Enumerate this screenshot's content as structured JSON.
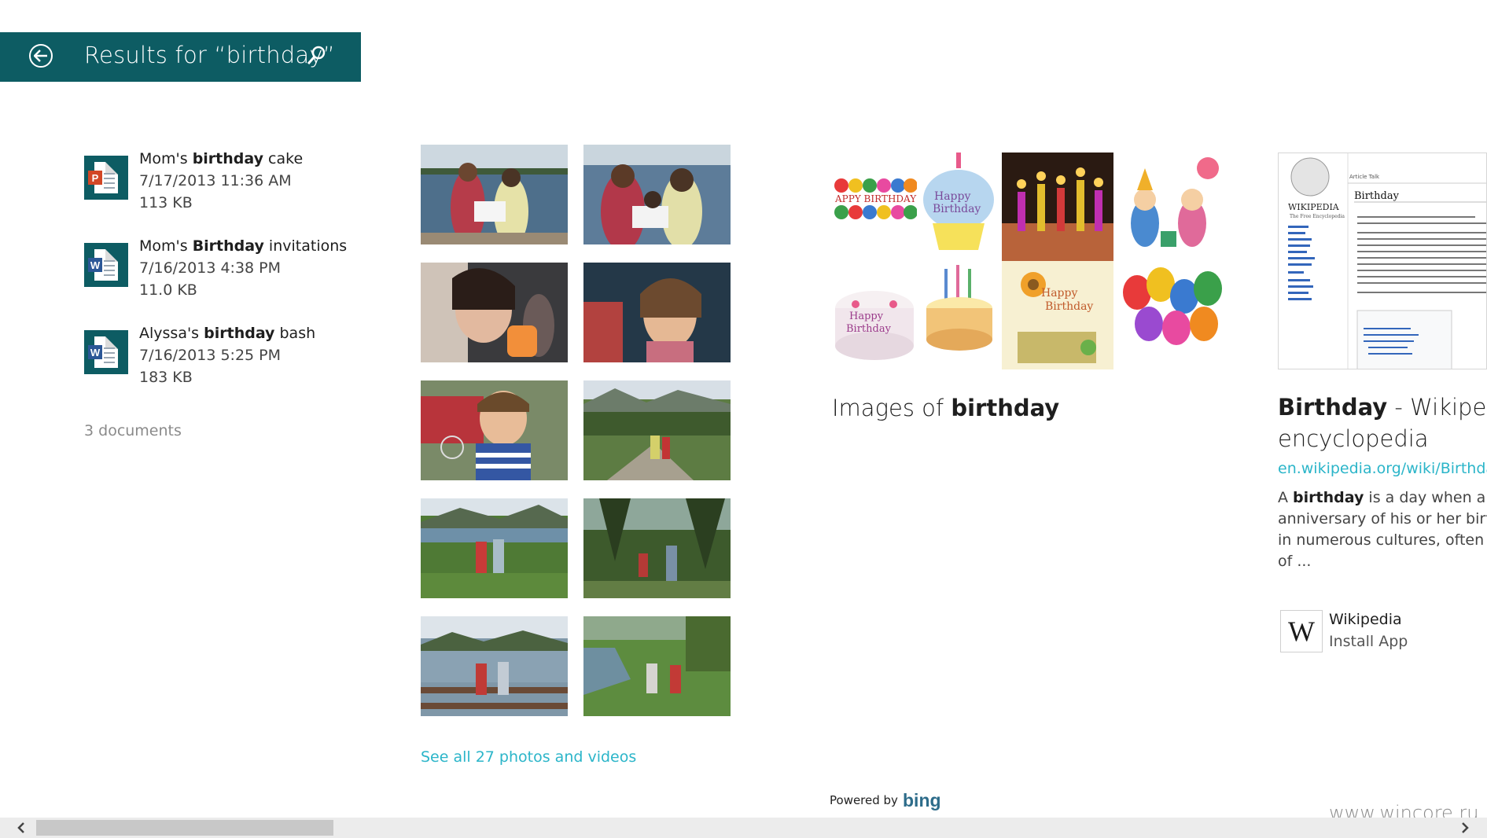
{
  "header": {
    "back_icon": "back-arrow-icon",
    "title": "Results for “birthday”",
    "search_icon": "search-icon",
    "color": "#0d5c63"
  },
  "documents": {
    "items": [
      {
        "pre": "Mom's ",
        "bold": "birthday",
        "post": " cake",
        "date": "7/17/2013 11:36 AM",
        "size": "113 KB",
        "type": "ppt",
        "badge": "P"
      },
      {
        "pre": "Mom's ",
        "bold": "Birthday",
        "post": " invitations",
        "date": "7/16/2013 4:38 PM",
        "size": "11.0 KB",
        "type": "word",
        "badge": "W"
      },
      {
        "pre": "Alyssa's ",
        "bold": "birthday",
        "post": " bash",
        "date": "7/16/2013 5:25 PM",
        "size": "183 KB",
        "type": "word",
        "badge": "W"
      }
    ],
    "count_label": "3 documents"
  },
  "photos": {
    "see_all": "See all 27 photos and videos"
  },
  "bing_images": {
    "caption_pre": "Images of ",
    "caption_bold": "birthday"
  },
  "wikipedia": {
    "thumb_logo_text": "WIKIPEDIA",
    "thumb_tagline": "The Free Encyclopedia",
    "thumb_heading": "Birthday",
    "thumb_tabs": "Article  Talk",
    "title_bold": "Birthday",
    "title_rest": " - Wikipedia,",
    "title_line2": "encyclopedia",
    "url": "en.wikipedia.org/wiki/Birthday",
    "snippet_line1_pre": "A ",
    "snippet_line1_bold": "birthday",
    "snippet_line1_post": " is a day when a pe",
    "snippet_line2": "anniversary of his or her birth.",
    "snippet_line3": "in numerous cultures, often wi",
    "snippet_line4": "of ...",
    "app_name": "Wikipedia",
    "app_action": "Install App",
    "app_logo": "W"
  },
  "footer": {
    "powered_by": "Powered by",
    "bing": "bing",
    "watermark": "www.wincore.ru"
  },
  "scrollbar": {
    "left_icon": "chevron-left-icon",
    "right_icon": "chevron-right-icon"
  }
}
